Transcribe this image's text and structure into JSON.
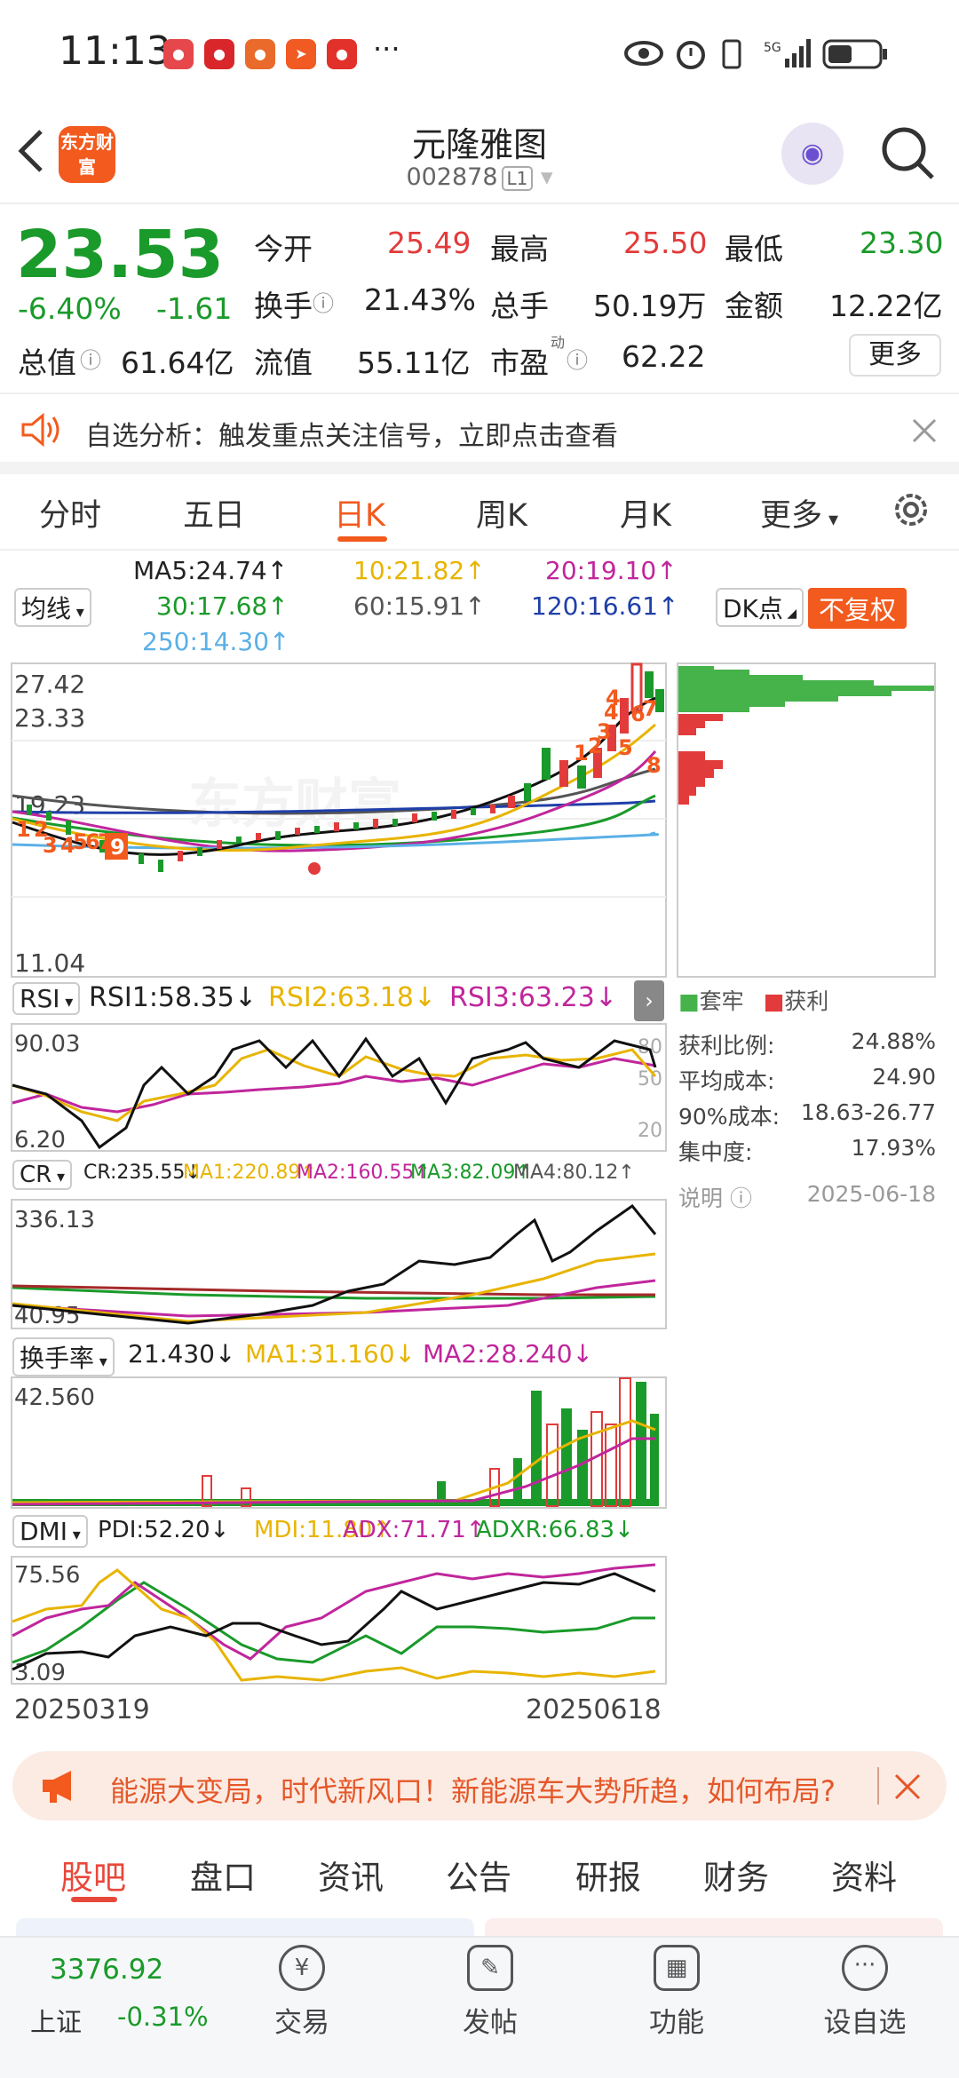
{
  "status_bar": {
    "time": "11:13",
    "more": "···",
    "network": "5G"
  },
  "header": {
    "title": "元隆雅图",
    "code": "002878",
    "board_tag": "L1",
    "logo_text": "东方财富"
  },
  "quote": {
    "price": "23.53",
    "change_pct": "-6.40%",
    "change": "-1.61",
    "fields": [
      {
        "label": "今开",
        "value": "25.49"
      },
      {
        "label": "最高",
        "value": "25.50"
      },
      {
        "label": "最低",
        "value": "23.30"
      },
      {
        "label": "换手",
        "value": "21.43%"
      },
      {
        "label": "总手",
        "value": "50.19万"
      },
      {
        "label": "金额",
        "value": "12.22亿"
      },
      {
        "label": "总值",
        "value": "61.64亿"
      },
      {
        "label": "流值",
        "value": "55.11亿"
      },
      {
        "label": "市盈",
        "value": "62.22"
      }
    ],
    "pe_sup": "动",
    "more_button": "更多"
  },
  "notice": {
    "text": "自选分析：触发重点关注信号，立即点击查看"
  },
  "period_tabs": [
    "分时",
    "五日",
    "日K",
    "周K",
    "月K",
    "更多"
  ],
  "active_period": "日K",
  "ma": {
    "selector": "均线",
    "ma5": "MA5:24.74↑",
    "ma10": "10:21.82↑",
    "ma20": "20:19.10↑",
    "ma30": "30:17.68↑",
    "ma60": "60:15.91↑",
    "ma120": "120:16.61↑",
    "ma250": "250:14.30↑",
    "dk_button": "DK点",
    "adjust_button": "不复权"
  },
  "kline_axis": [
    "27.42",
    "23.33",
    "19.23",
    "11.04"
  ],
  "kline_markers": [
    "1",
    "2",
    "3",
    "4",
    "5",
    "6",
    "7",
    "8",
    "9"
  ],
  "watermark": "东方财富",
  "rsi": {
    "selector": "RSI",
    "rsi1": "RSI1:58.35↓",
    "rsi2": "RSI2:63.18↓",
    "rsi3": "RSI3:63.23↓",
    "max": "90.03",
    "min": "6.20",
    "r80": "80",
    "r50": "50",
    "r20": "20"
  },
  "cr": {
    "selector": "CR",
    "cr": "CR:235.55↓",
    "ma1": "MA1:220.89↑",
    "ma2": "MA2:160.55↑",
    "ma3": "MA3:82.09↑",
    "ma4": "MA4:80.12↑",
    "max": "336.13",
    "min": "40.95"
  },
  "turnover": {
    "selector": "换手率",
    "value": "21.430↓",
    "ma1": "MA1:31.160↓",
    "ma2": "MA2:28.240↓",
    "max": "42.560"
  },
  "dmi": {
    "selector": "DMI",
    "pdi": "PDI:52.20↓",
    "mdi": "MDI:11.80↑",
    "adx": "ADX:71.71↑",
    "adxr": "ADXR:66.83↓",
    "max": "75.56",
    "min": "3.09"
  },
  "dates": {
    "start": "20250319",
    "end": "20250618"
  },
  "chip": {
    "legend_trapped": "套牢",
    "legend_profit": "获利",
    "rows": [
      {
        "label": "获利比例:",
        "value": "24.88%"
      },
      {
        "label": "平均成本:",
        "value": "24.90"
      },
      {
        "label": "90%成本:",
        "value": "18.63-26.77"
      },
      {
        "label": "集中度:",
        "value": "17.93%"
      }
    ],
    "note_label": "说明",
    "date": "2025-06-18"
  },
  "ad": {
    "text": "能源大变局，时代新风口！新能源车大势所趋，如何布局?"
  },
  "bottom_tabs": [
    "股吧",
    "盘口",
    "资讯",
    "公告",
    "研报",
    "财务",
    "资料"
  ],
  "nav": {
    "index_value": "3376.92",
    "index_name": "上证",
    "index_change": "-0.31%",
    "items": [
      {
        "label": "交易",
        "icon": "¥"
      },
      {
        "label": "发帖",
        "icon": "✎"
      },
      {
        "label": "功能",
        "icon": "▦"
      },
      {
        "label": "设自选",
        "icon": "···"
      }
    ]
  },
  "colors": {
    "up": "#e23b3b",
    "down": "#1a9a2a",
    "accent": "#f25a1e",
    "ma10": "#e8b400",
    "ma20": "#c0269c",
    "ma60": "#555555",
    "ma120": "#1f3fa8",
    "ma250": "#5ab0e6"
  }
}
